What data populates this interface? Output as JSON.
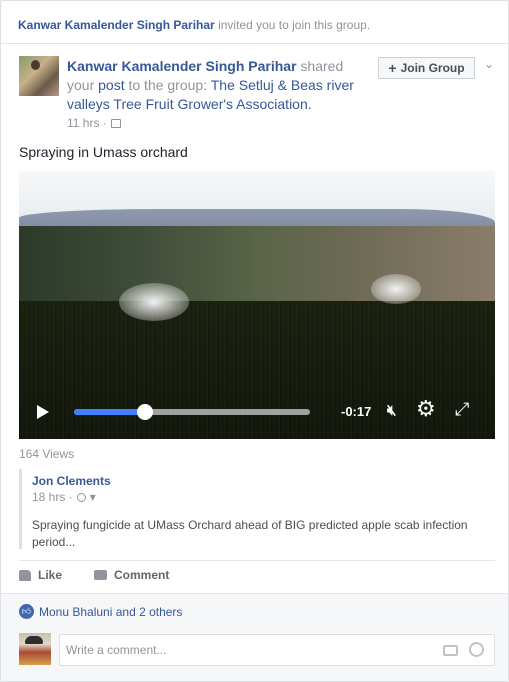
{
  "invite": {
    "inviter": "Kanwar Kamalender Singh Parihar",
    "text": " invited you to join this group."
  },
  "post": {
    "author": "Kanwar Kamalender Singh Parihar",
    "shared_word": " shared",
    "your": "your ",
    "post_link": "post",
    "to_group": " to the group: ",
    "group_name": "The Setluj & Beas river valleys Tree Fruit Grower's Association.",
    "time": "11 hrs · ",
    "join_label": "Join Group",
    "text": "Spraying in Umass orchard"
  },
  "video": {
    "time_remaining": "-0:17",
    "progress": 0.3
  },
  "views": "164 Views",
  "shared": {
    "author": "Jon Clements",
    "time": "18 hrs · ",
    "text": "Spraying fungicide at UMass Orchard ahead of BIG predicted apple scab infection period..."
  },
  "actions": {
    "like": "Like",
    "comment": "Comment"
  },
  "likes_summary": "Monu Bhaluni and 2 others",
  "comment_box": {
    "placeholder": "Write a comment..."
  }
}
